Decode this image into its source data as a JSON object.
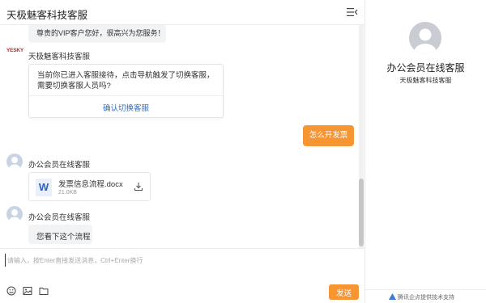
{
  "header": {
    "title": "天极魅客科技客服"
  },
  "messages": {
    "greeting": "尊贵的VIP客户您好，很高兴为您服务！",
    "bot_logo": "YESKY",
    "bot_sender": "天极魅客科技客服",
    "card_text": "当前你已进入客服接待，点击导航触发了切换客服，需要切换客服人员吗?",
    "card_action": "确认切换客服",
    "user_message": "怎么开发票",
    "agent_sender_1": "办公会员在线客服",
    "file": {
      "icon_letter": "W",
      "name": "发票信息流程.docx",
      "size": "21.0KB"
    },
    "agent_sender_2": "办公会员在线客服",
    "agent_message": "您看下这个流程"
  },
  "input": {
    "placeholder": "请输入，按Enter直接发送消息，Ctrl+Enter换行",
    "send_label": "发送"
  },
  "agent_info": {
    "name": "办公会员在线客服",
    "company": "天极魅客科技客服"
  },
  "footer": {
    "text": "腾讯企点提供技术支持"
  },
  "colors": {
    "accent": "#f79533",
    "link": "#2a6fc9",
    "bubble": "#f2f3f5"
  }
}
